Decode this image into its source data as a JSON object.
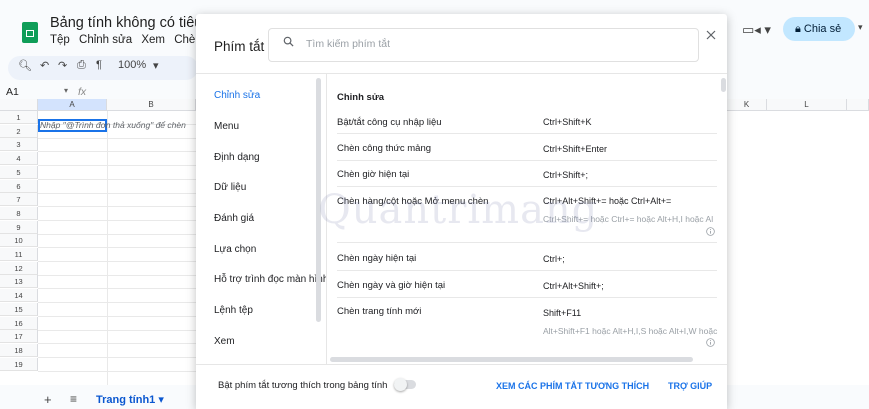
{
  "app": {
    "doc_title": "Bảng tính không có tiêu đề",
    "menu": [
      "Tệp",
      "Chỉnh sửa",
      "Xem",
      "Chèn"
    ],
    "zoom": "100%",
    "name_box": "A1",
    "fx_label": "fx",
    "col_headers": [
      "A",
      "B"
    ],
    "right_col_headers": [
      "K",
      "L"
    ],
    "row_numbers": [
      "1",
      "2",
      "3",
      "4",
      "5",
      "6",
      "7",
      "8",
      "9",
      "10",
      "11",
      "12",
      "13",
      "14",
      "15",
      "16",
      "17",
      "18",
      "19"
    ],
    "cell_hint": "Nhập \"@Trình đơn thả xuống\" để chèn",
    "share_label": "Chia sẻ",
    "add_sheet": "+",
    "sheet_list": "≡",
    "sheet_tab": "Trang tính1 ▾"
  },
  "dialog": {
    "title": "Phím tắt",
    "search_placeholder": "Tìm kiếm phím tắt",
    "categories": [
      {
        "label": "Chỉnh sửa",
        "active": true
      },
      {
        "label": "Menu"
      },
      {
        "label": "Định dạng"
      },
      {
        "label": "Dữ liệu"
      },
      {
        "label": "Đánh giá"
      },
      {
        "label": "Lựa chọn"
      },
      {
        "label": "Hỗ trợ trình đọc màn hình"
      },
      {
        "label": "Lệnh tệp"
      },
      {
        "label": "Xem"
      }
    ],
    "section_title": "Chỉnh sửa",
    "shortcuts": [
      {
        "name": "Bật/tắt công cụ nhập liệu",
        "keys": "Ctrl+Shift+K"
      },
      {
        "name": "Chèn công thức mảng",
        "keys": "Ctrl+Shift+Enter"
      },
      {
        "name": "Chèn giờ hiện tại",
        "keys": "Ctrl+Shift+;"
      },
      {
        "name": "Chèn hàng/cột hoặc Mở menu chèn",
        "keys": "Ctrl+Alt+Shift+= hoặc Ctrl+Alt+=",
        "alt": "Ctrl+Shift+= hoặc Ctrl+= hoặc Alt+H,I hoặc Al"
      },
      {
        "name": "Chèn ngày hiện tại",
        "keys": "Ctrl+;"
      },
      {
        "name": "Chèn ngày và giờ hiện tại",
        "keys": "Ctrl+Alt+Shift+;"
      },
      {
        "name": "Chèn trang tính mới",
        "keys": "Shift+F11",
        "alt": "Alt+Shift+F1 hoặc Alt+H,I,S hoặc Alt+I,W hoặc"
      }
    ],
    "compat_label": "Bật phím tắt tương thích trong bảng tính",
    "compat_enabled": false,
    "view_compat_button": "XEM CÁC PHÍM TẮT TƯƠNG THÍCH",
    "help_button": "TRỢ GIÚP"
  },
  "watermark": "Quantrimang",
  "colors": {
    "accent": "#1a73e8",
    "share_bg": "#c2e7ff",
    "sheets_green": "#0f9d58"
  }
}
